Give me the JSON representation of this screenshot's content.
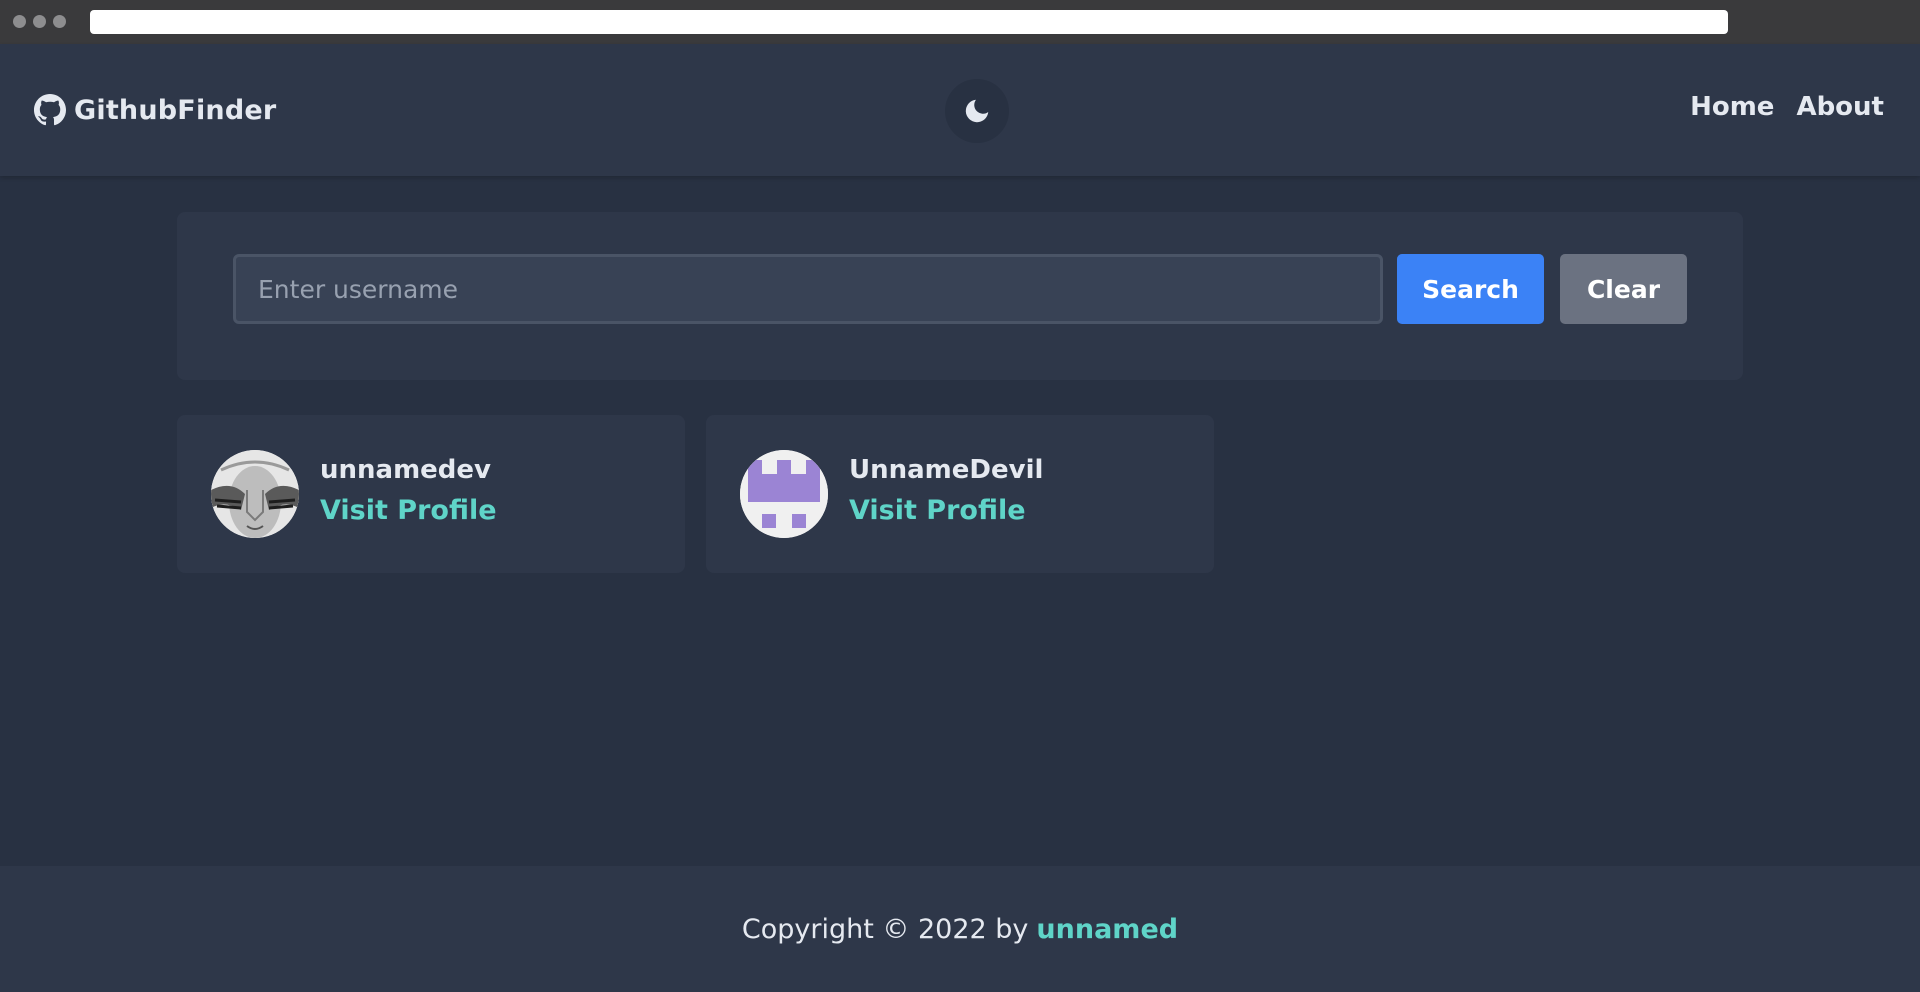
{
  "navbar": {
    "brand": "GithubFinder",
    "brand_icon": "github-icon",
    "theme_icon": "moon-icon",
    "links": [
      {
        "label": "Home"
      },
      {
        "label": "About"
      }
    ]
  },
  "search": {
    "placeholder": "Enter username",
    "value": "",
    "search_label": "Search",
    "clear_label": "Clear"
  },
  "users": [
    {
      "login": "unnamedev",
      "link_label": "Visit Profile",
      "avatar_icon": "user-avatar-photo"
    },
    {
      "login": "UnnameDevil",
      "link_label": "Visit Profile",
      "avatar_icon": "identicon-avatar"
    }
  ],
  "footer": {
    "text": "Copyright © 2022 by",
    "author": "unnamed"
  },
  "colors": {
    "background": "#283142",
    "surface": "#2e3749",
    "primary": "#3b82f6",
    "neutral": "#6b7281",
    "accent": "#5fd4c8"
  }
}
